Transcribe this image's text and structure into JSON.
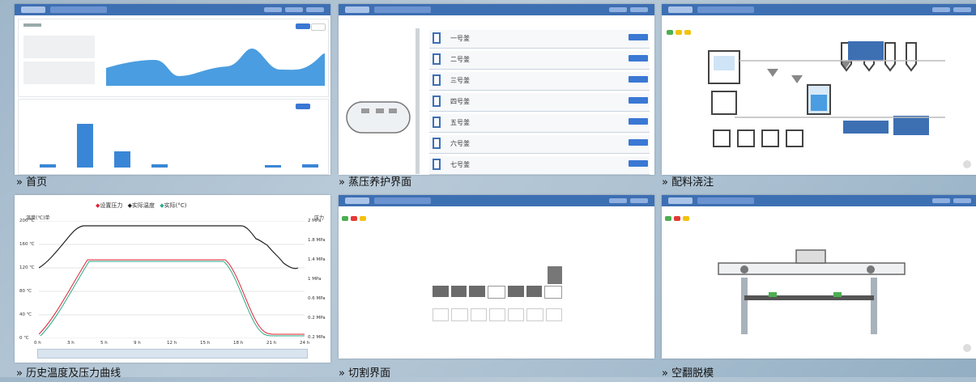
{
  "captions": {
    "t1": "» 首页",
    "t2": "» 蒸压养护界面",
    "t3": "» 配料浇注",
    "t4": "» 历史温度及压力曲线",
    "t5": "» 切割界面",
    "t6": "» 空翻脱模"
  },
  "colors": {
    "header_blue": "#3d6fb3",
    "chart_blue": "#4a9de0",
    "button_blue": "#3a78d4",
    "status_green": "#4caf50",
    "status_red": "#e53935",
    "status_yellow": "#f4c20d"
  },
  "steam": {
    "rows": [
      "一号釜",
      "二号釜",
      "三号釜",
      "四号釜",
      "五号釜",
      "六号釜",
      "七号釜"
    ]
  },
  "history_chart": {
    "legend": [
      "设置压力",
      "实际温度",
      "实际(°C)"
    ],
    "ylabel_left": "温度(℃)单",
    "ylabel_right": "压力",
    "left_ticks": [
      "200 ℃",
      "160 ℃",
      "120 ℃",
      "80 ℃",
      "40 ℃",
      "0 ℃"
    ],
    "right_ticks": [
      "2 MPa",
      "1.8 MPa",
      "1.4 MPa",
      "1 MPa",
      "0.6 MPa",
      "0.2 MPa",
      "0.2 MPa"
    ],
    "x_ticks": [
      "0 h",
      "3 h",
      "5 h",
      "9 h",
      "12 h",
      "15 h",
      "18 h",
      "21 h",
      "24 h"
    ]
  }
}
